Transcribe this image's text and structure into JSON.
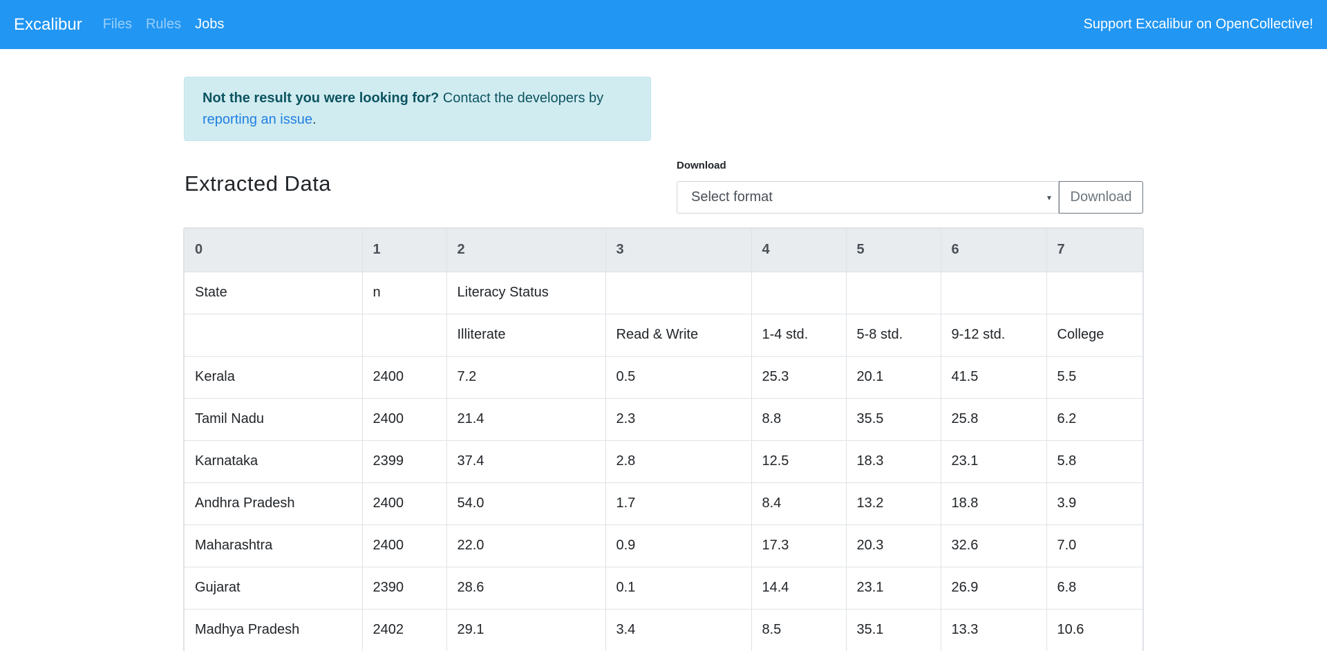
{
  "navbar": {
    "brand": "Excalibur",
    "links": [
      "Files",
      "Rules",
      "Jobs"
    ],
    "active": "Jobs",
    "support": "Support Excalibur on OpenCollective!"
  },
  "alert": {
    "strong": "Not the result you were looking for?",
    "text": " Contact the developers by ",
    "link": "reporting an issue",
    "end": "."
  },
  "section_title": "Extracted Data",
  "download": {
    "label": "Download",
    "select_value": "Select format",
    "button": "Download"
  },
  "table": {
    "headers": [
      "0",
      "1",
      "2",
      "3",
      "4",
      "5",
      "6",
      "7"
    ],
    "rows": [
      [
        "State",
        "n",
        "Literacy Status",
        "",
        "",
        "",
        "",
        ""
      ],
      [
        "",
        "",
        "Illiterate",
        "Read & Write",
        "1-4 std.",
        "5-8 std.",
        "9-12 std.",
        "College"
      ],
      [
        "Kerala",
        "2400",
        "7.2",
        "0.5",
        "25.3",
        "20.1",
        "41.5",
        "5.5"
      ],
      [
        "Tamil Nadu",
        "2400",
        "21.4",
        "2.3",
        "8.8",
        "35.5",
        "25.8",
        "6.2"
      ],
      [
        "Karnataka",
        "2399",
        "37.4",
        "2.8",
        "12.5",
        "18.3",
        "23.1",
        "5.8"
      ],
      [
        "Andhra Pradesh",
        "2400",
        "54.0",
        "1.7",
        "8.4",
        "13.2",
        "18.8",
        "3.9"
      ],
      [
        "Maharashtra",
        "2400",
        "22.0",
        "0.9",
        "17.3",
        "20.3",
        "32.6",
        "7.0"
      ],
      [
        "Gujarat",
        "2390",
        "28.6",
        "0.1",
        "14.4",
        "23.1",
        "26.9",
        "6.8"
      ],
      [
        "Madhya Pradesh",
        "2402",
        "29.1",
        "3.4",
        "8.5",
        "35.1",
        "13.3",
        "10.6"
      ]
    ]
  }
}
